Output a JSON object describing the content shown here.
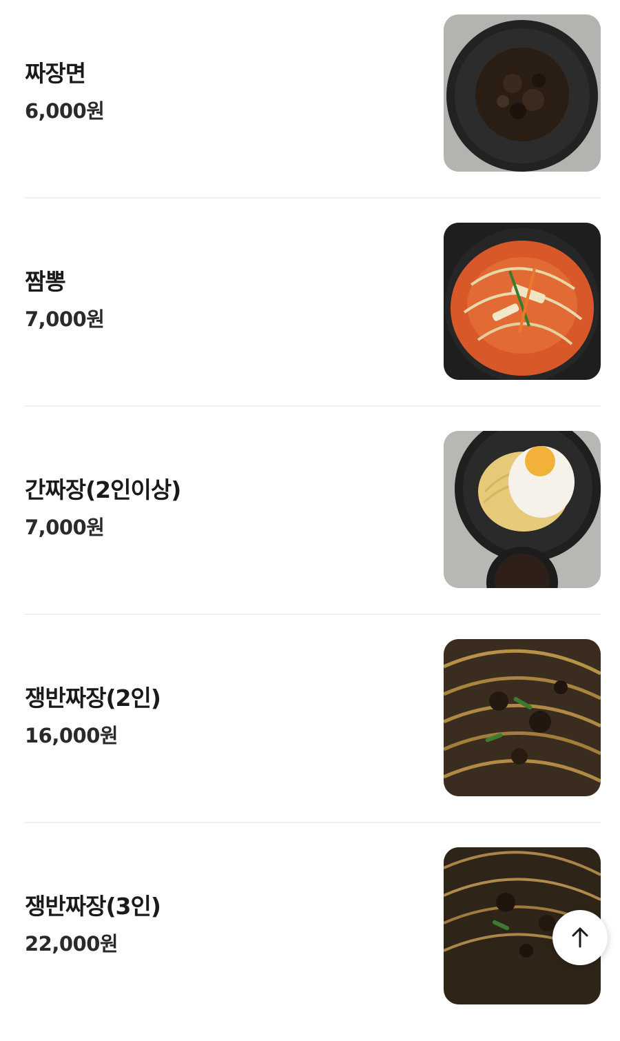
{
  "menu": [
    {
      "name": "짜장면",
      "price": "6,000원",
      "image": "jjajangmyeon-photo"
    },
    {
      "name": "짬뽕",
      "price": "7,000원",
      "image": "jjamppong-photo"
    },
    {
      "name": "간짜장(2인이상)",
      "price": "7,000원",
      "image": "ganjjajang-photo"
    },
    {
      "name": "쟁반짜장(2인)",
      "price": "16,000원",
      "image": "jaengban-jjajang-2-photo"
    },
    {
      "name": "쟁반짜장(3인)",
      "price": "22,000원",
      "image": "jaengban-jjajang-3-photo"
    }
  ],
  "scroll_top": {
    "icon": "arrow-up-icon"
  }
}
